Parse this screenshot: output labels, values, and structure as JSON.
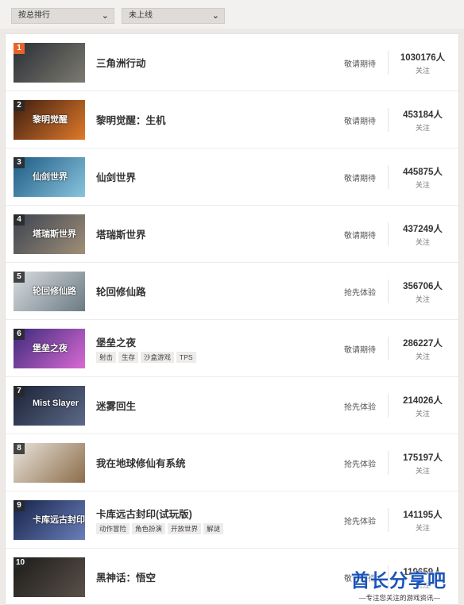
{
  "filters": {
    "sort_label": "按总排行",
    "status_label": "未上线"
  },
  "games": [
    {
      "rank": "1",
      "name": "三角洲行动",
      "status": "敬请期待",
      "count": "1030176人",
      "follow": "关注",
      "tags": [],
      "colors": [
        "#2a2f35",
        "#7d7a70"
      ]
    },
    {
      "rank": "2",
      "name": "黎明觉醒：生机",
      "status": "敬请期待",
      "count": "453184人",
      "follow": "关注",
      "tags": [],
      "art": "黎明觉醒",
      "colors": [
        "#3d1d10",
        "#e07a2a"
      ]
    },
    {
      "rank": "3",
      "name": "仙剑世界",
      "status": "敬请期待",
      "count": "445875人",
      "follow": "关注",
      "tags": [],
      "art": "仙剑世界",
      "colors": [
        "#1e5a83",
        "#89c4dd"
      ]
    },
    {
      "rank": "4",
      "name": "塔瑞斯世界",
      "status": "敬请期待",
      "count": "437249人",
      "follow": "关注",
      "tags": [],
      "art": "塔瑞斯世界",
      "colors": [
        "#3b4350",
        "#a08f78"
      ]
    },
    {
      "rank": "5",
      "name": "轮回修仙路",
      "status": "抢先体验",
      "count": "356706人",
      "follow": "关注",
      "tags": [],
      "art": "轮回修仙路",
      "colors": [
        "#d8dde0",
        "#6b7a83"
      ]
    },
    {
      "rank": "6",
      "name": "堡垒之夜",
      "status": "敬请期待",
      "count": "286227人",
      "follow": "关注",
      "tags": [
        "射击",
        "生存",
        "沙盒游戏",
        "TPS"
      ],
      "art": "堡垒之夜",
      "colors": [
        "#3b2a7a",
        "#d96ad4"
      ]
    },
    {
      "rank": "7",
      "name": "迷雾回生",
      "status": "抢先体验",
      "count": "214026人",
      "follow": "关注",
      "tags": [],
      "art": "Mist Slayer",
      "colors": [
        "#1b2236",
        "#5c6a88"
      ]
    },
    {
      "rank": "8",
      "name": "我在地球修仙有系统",
      "status": "抢先体验",
      "count": "175197人",
      "follow": "关注",
      "tags": [],
      "colors": [
        "#e9e4dc",
        "#8c6d4a"
      ]
    },
    {
      "rank": "9",
      "name": "卡库远古封印(试玩版)",
      "status": "抢先体验",
      "count": "141195人",
      "follow": "关注",
      "tags": [
        "动作冒险",
        "角色扮演",
        "开放世界",
        "解谜"
      ],
      "art": "卡库远古封印",
      "colors": [
        "#15234a",
        "#6a7fb9"
      ]
    },
    {
      "rank": "10",
      "name": "黑神话：悟空",
      "status": "敬请期待",
      "count": "119659人",
      "follow": "关注",
      "tags": [],
      "colors": [
        "#1c1b1a",
        "#5a5149"
      ]
    }
  ],
  "watermark": {
    "brand": "酋长分享吧",
    "slogan": "—专注您关注的游戏资讯—"
  }
}
